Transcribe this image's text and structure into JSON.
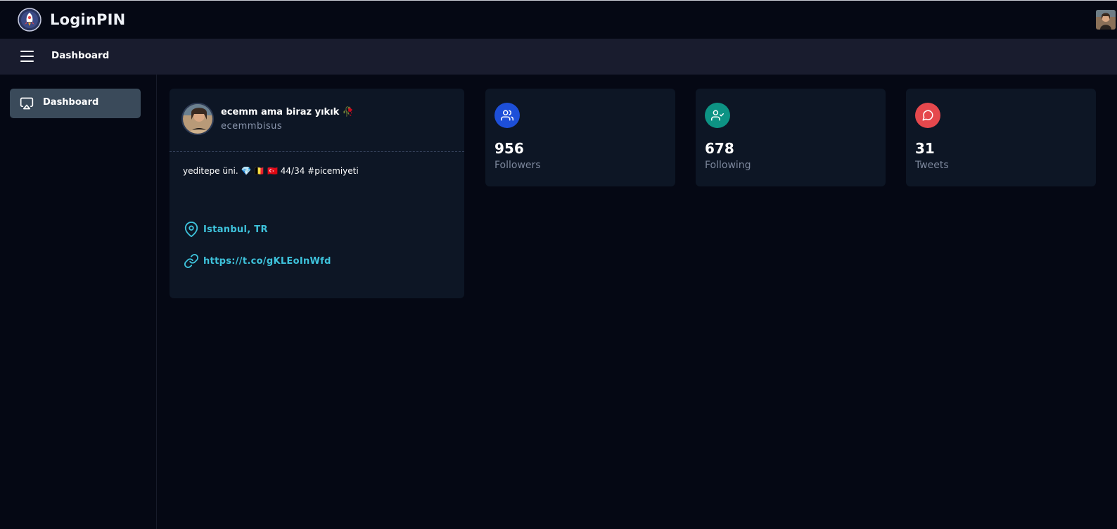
{
  "app": {
    "name": "LoginPIN"
  },
  "header": {
    "title": "Dashboard"
  },
  "sidebar": {
    "items": [
      {
        "label": "Dashboard",
        "icon": "airplay-icon"
      }
    ]
  },
  "profile": {
    "display_name": "ecemm ama biraz yıkık 🥀",
    "username": "ecemmbisus",
    "bio": "yeditepe üni. 💎 🇧🇪 🇹🇷 44/34 #picemiyeti",
    "location": "Istanbul, TR",
    "url": "https://t.co/gKLEoInWfd"
  },
  "stats": [
    {
      "value": "956",
      "label": "Followers",
      "icon": "users-icon",
      "color": "#1d4fd8"
    },
    {
      "value": "678",
      "label": "Following",
      "icon": "user-check-icon",
      "color": "#0d9384"
    },
    {
      "value": "31",
      "label": "Tweets",
      "icon": "message-circle-icon",
      "color": "#e5484d"
    }
  ],
  "colors": {
    "accent": "#3ec3dc",
    "background": "#050814",
    "card": "#0d1625"
  }
}
